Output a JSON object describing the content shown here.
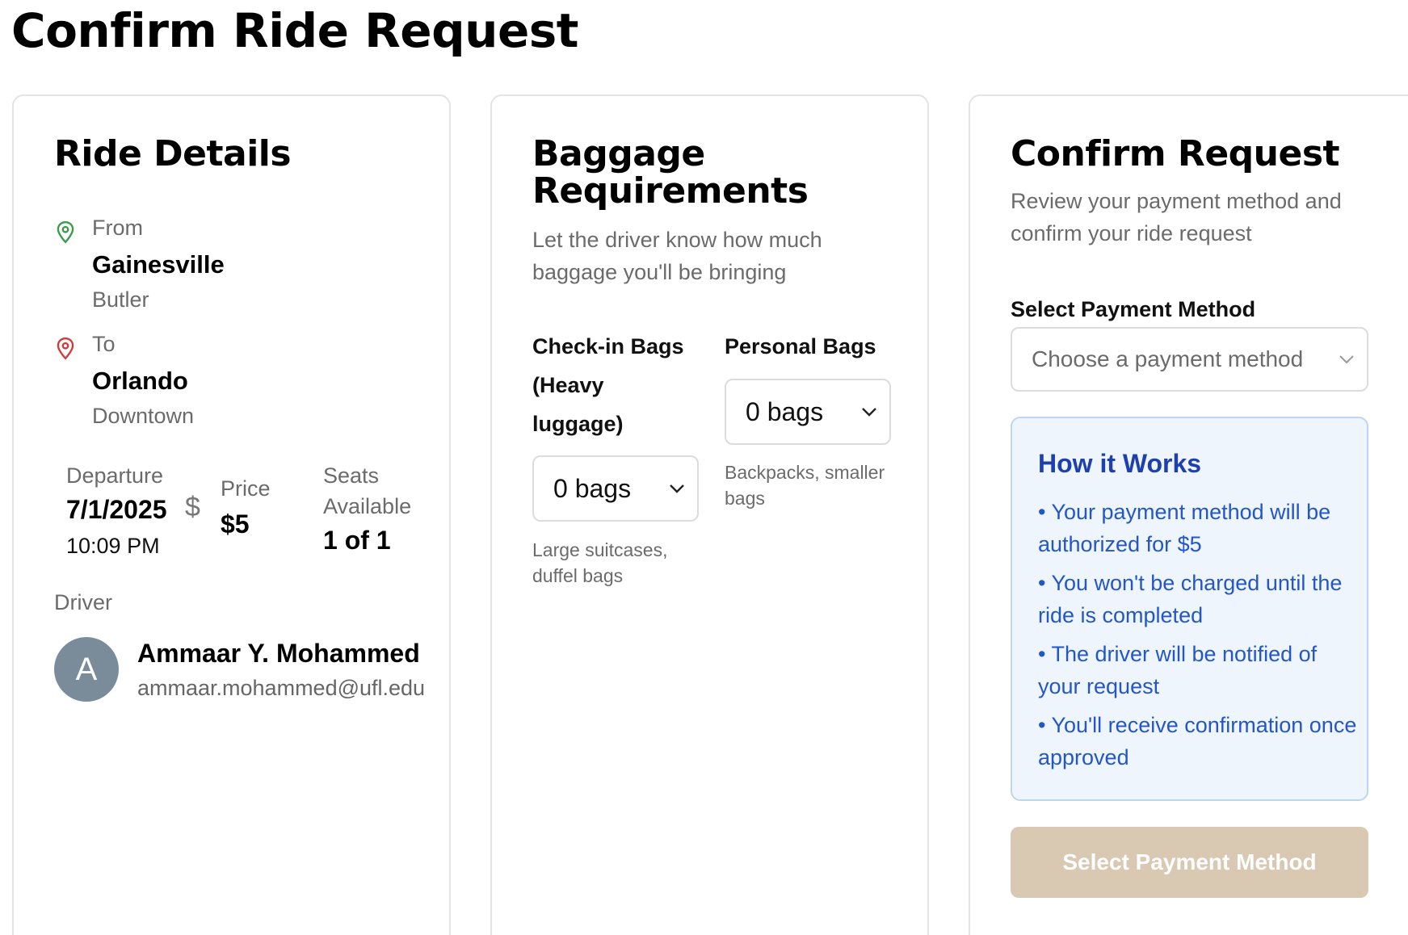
{
  "page": {
    "title": "Confirm Ride Request"
  },
  "ride_details": {
    "title": "Ride Details",
    "from": {
      "label": "From",
      "city": "Gainesville",
      "area": "Butler"
    },
    "to": {
      "label": "To",
      "city": "Orlando",
      "area": "Downtown"
    },
    "departure": {
      "label": "Departure",
      "date": "7/1/2025",
      "time": "10:09 PM"
    },
    "price": {
      "label": "Price",
      "value": "$5",
      "icon": "dollar-icon"
    },
    "seats": {
      "label_line1": "Seats",
      "label_line2": "Available",
      "value": "1 of 1"
    },
    "driver": {
      "label": "Driver",
      "initial": "A",
      "name": "Ammaar Y. Mohammed",
      "email": "ammaar.mohammed@ufl.edu"
    }
  },
  "baggage": {
    "title_line1": "Baggage",
    "title_line2": "Requirements",
    "subtitle_line1": "Let the driver know how much",
    "subtitle_line2": "baggage you'll be bringing",
    "checkin": {
      "label_line1": "Check-in Bags",
      "label_line2": "(Heavy",
      "label_line3": "luggage)",
      "value": "0 bags",
      "hint_line1": "Large suitcases,",
      "hint_line2": "duffel bags"
    },
    "personal": {
      "label": "Personal Bags",
      "value": "0 bags",
      "hint_line1": "Backpacks, smaller",
      "hint_line2": "bags"
    }
  },
  "confirm": {
    "title": "Confirm Request",
    "subtitle_line1": "Review your payment method and",
    "subtitle_line2": "confirm your ride request",
    "payment_label": "Select Payment Method",
    "payment_placeholder": "Choose a payment method",
    "how_title": "How it Works",
    "how_items": [
      "• Your payment method will be authorized for $5",
      "• You won't be charged until the ride is completed",
      "• The driver will be notified of your request",
      "• You'll receive confirmation once approved"
    ],
    "button_label": "Select Payment Method"
  },
  "colors": {
    "from_pin": "#3a9b4a",
    "to_pin": "#d23b3b",
    "info_text": "#2456c8",
    "button_disabled": "#d9c8b2"
  }
}
